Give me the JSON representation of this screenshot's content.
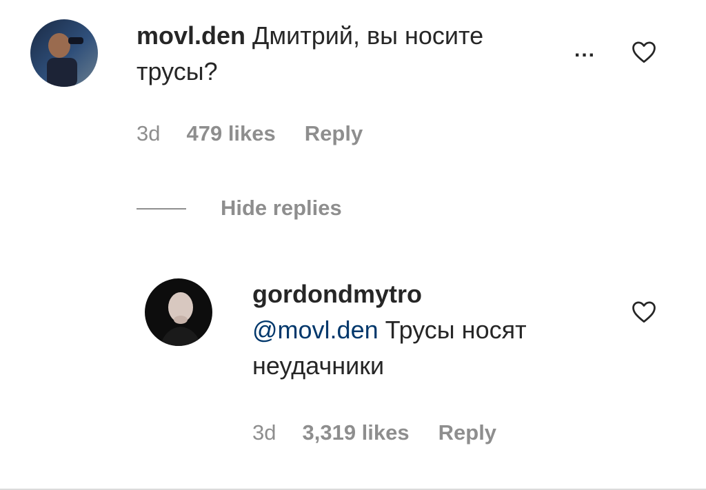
{
  "comment": {
    "username": "movl.den",
    "text_line1": "Дмитрий, вы носите",
    "text_line2": "трусы?",
    "time": "3d",
    "likes": "479 likes",
    "reply": "Reply",
    "more": "...",
    "icons": {
      "like": "heart-icon",
      "options": "more-options-icon",
      "avatar": "avatar"
    }
  },
  "thread": {
    "hide_replies": "Hide replies"
  },
  "reply_comment": {
    "username": "gordondmytro",
    "mention": "@movl.den",
    "text_line1": " Трусы носят",
    "text_line2": "неудачники",
    "time": "3d",
    "likes": "3,319 likes",
    "reply": "Reply",
    "icons": {
      "like": "heart-icon",
      "avatar": "avatar"
    }
  },
  "colors": {
    "text": "#262626",
    "muted": "#8e8e8e",
    "mention": "#00376b"
  }
}
